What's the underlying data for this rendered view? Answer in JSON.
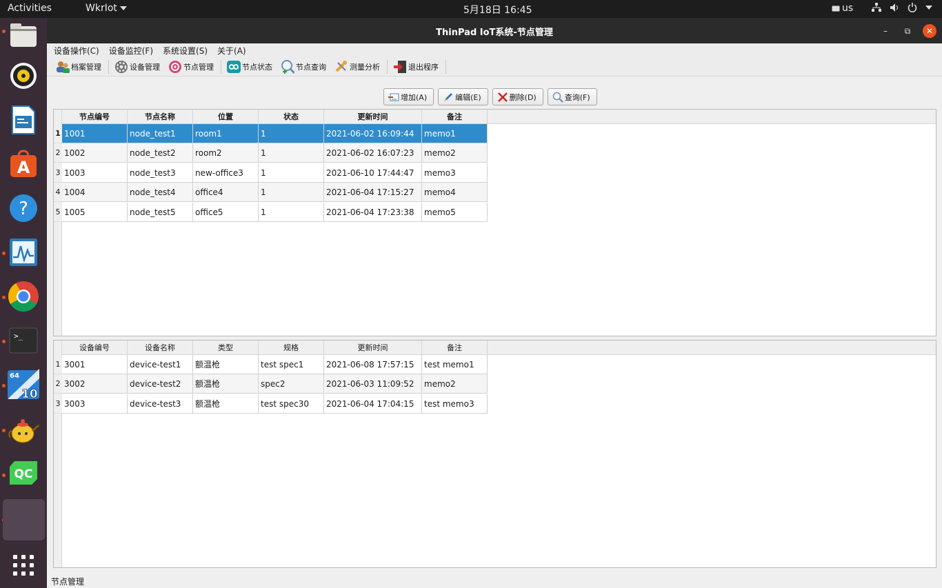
{
  "topbar": {
    "activities": "Activities",
    "app_menu": "WkrIot",
    "clock": "5月18日  16:45",
    "keyboard": "us",
    "icons": [
      "network-icon",
      "volume-icon",
      "power-icon",
      "chevron-down-icon"
    ]
  },
  "dock": {
    "apps": [
      {
        "name": "files-app-icon",
        "active": true
      },
      {
        "name": "rhythmbox-app-icon",
        "active": false
      },
      {
        "name": "libreoffice-writer-app-icon",
        "active": false
      },
      {
        "name": "software-center-app-icon",
        "active": false
      },
      {
        "name": "help-app-icon",
        "active": false
      },
      {
        "name": "system-monitor-app-icon",
        "active": true
      },
      {
        "name": "chrome-app-icon",
        "active": true
      },
      {
        "name": "terminal-app-icon",
        "active": true
      },
      {
        "name": "vm-64-10-app-icon",
        "active": true
      },
      {
        "name": "teapot-app-icon",
        "active": true
      },
      {
        "name": "qtcreator-app-icon",
        "active": true
      },
      {
        "name": "running-app-icon",
        "active": true
      },
      {
        "name": "show-applications-icon",
        "active": false
      }
    ],
    "qc_label": "QC",
    "vm_label_top": "64",
    "vm_label_num": "10"
  },
  "window": {
    "title": "ThinPad IoT系统-节点管理",
    "menus": [
      "设备操作(C)",
      "设备监控(F)",
      "系统设置(S)",
      "关于(A)"
    ],
    "toolbar": [
      {
        "label": "档案管理",
        "icon": "users-icon"
      },
      {
        "label": "设备管理",
        "icon": "gear-icon"
      },
      {
        "label": "节点管理",
        "icon": "node-icon"
      },
      {
        "label": "节点状态",
        "icon": "infinity-icon"
      },
      {
        "label": "节点查询",
        "icon": "magnifier-add-icon"
      },
      {
        "label": "测量分析",
        "icon": "tools-icon"
      },
      {
        "label": "退出程序",
        "icon": "exit-icon"
      }
    ],
    "actions": [
      {
        "label": "增加(A)",
        "icon": "add-icon"
      },
      {
        "label": "编辑(E)",
        "icon": "edit-icon"
      },
      {
        "label": "删除(D)",
        "icon": "delete-icon"
      },
      {
        "label": "查询(F)",
        "icon": "search-icon"
      }
    ],
    "status": "节点管理"
  },
  "nodes_table": {
    "columns": [
      "节点编号",
      "节点名称",
      "位置",
      "状态",
      "更新时间",
      "备注"
    ],
    "rows": [
      [
        "1001",
        "node_test1",
        "room1",
        "1",
        "2021-06-02 16:09:44",
        "memo1"
      ],
      [
        "1002",
        "node_test2",
        "room2",
        "1",
        "2021-06-02 16:07:23",
        "memo2"
      ],
      [
        "1003",
        "node_test3",
        "new-office3",
        "1",
        "2021-06-10 17:44:47",
        "memo3"
      ],
      [
        "1004",
        "node_test4",
        "office4",
        "1",
        "2021-06-04 17:15:27",
        "memo4"
      ],
      [
        "1005",
        "node_test5",
        "office5",
        "1",
        "2021-06-04 17:23:38",
        "memo5"
      ]
    ],
    "row_numbers": [
      "1",
      "2",
      "3",
      "4",
      "5"
    ],
    "selected_row": 0
  },
  "devices_table": {
    "columns": [
      "设备编号",
      "设备名称",
      "类型",
      "规格",
      "更新时间",
      "备注"
    ],
    "rows": [
      [
        "3001",
        "device-test1",
        "额温枪",
        "test spec1",
        "2021-06-08 17:57:15",
        "test memo1"
      ],
      [
        "3002",
        "device-test2",
        "额温枪",
        "spec2",
        "2021-06-03 11:09:52",
        "memo2"
      ],
      [
        "3003",
        "device-test3",
        "额温枪",
        "test spec30",
        "2021-06-04 17:04:15",
        "test memo3"
      ]
    ],
    "row_numbers": [
      "1",
      "2",
      "3"
    ]
  },
  "colors": {
    "selection": "#2f8ccc",
    "accent": "#e95420",
    "dock": "#3a2c36",
    "titlebar": "#2b2b2b"
  }
}
